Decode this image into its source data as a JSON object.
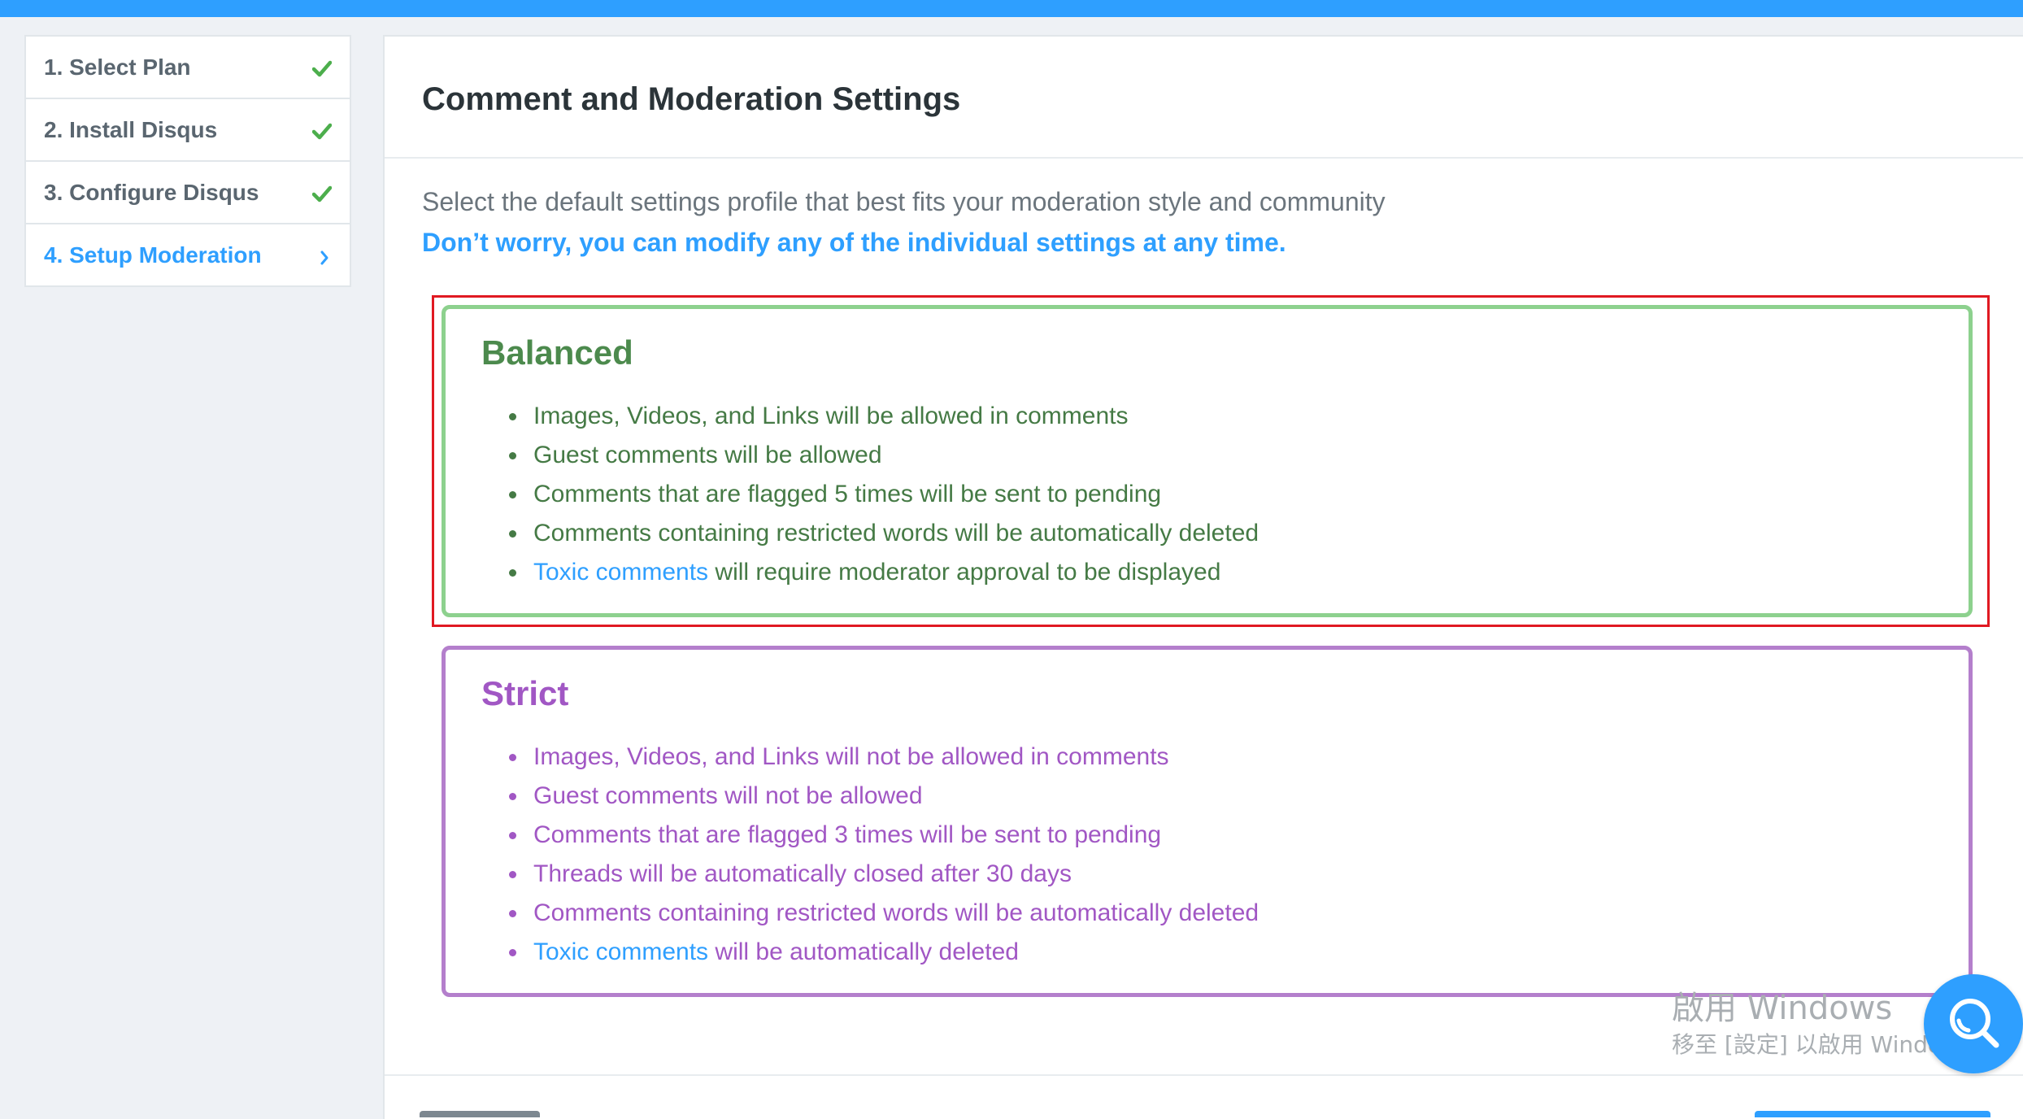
{
  "colors": {
    "brand_blue": "#2e9fff",
    "balanced_green": "#4c8a4d",
    "strict_purple": "#a157c4",
    "highlight_red": "#e01922"
  },
  "sidebar": {
    "steps": [
      {
        "label": "1. Select Plan",
        "state": "completed",
        "icon": "check-icon"
      },
      {
        "label": "2. Install Disqus",
        "state": "completed",
        "icon": "check-icon"
      },
      {
        "label": "3. Configure Disqus",
        "state": "completed",
        "icon": "check-icon"
      },
      {
        "label": "4. Setup Moderation",
        "state": "active",
        "icon": "chevron-right-icon"
      }
    ]
  },
  "main": {
    "title": "Comment and Moderation Settings",
    "intro": "Select the default settings profile that best fits your moderation style and community",
    "note": "Don’t worry, you can modify any of the individual settings at any time.",
    "profiles": [
      {
        "name": "Balanced",
        "items": [
          "Images, Videos, and Links will be allowed in comments",
          "Guest comments will be allowed",
          "Comments that are flagged 5 times will be sent to pending",
          "Comments containing restricted words will be automatically deleted"
        ],
        "toxic_link": "Toxic comments",
        "toxic_rest": " will require moderator approval to be displayed"
      },
      {
        "name": "Strict",
        "items": [
          "Images, Videos, and Links will not be allowed in comments",
          "Guest comments will not be allowed",
          "Comments that are flagged 3 times will be sent to pending",
          "Threads will be automatically closed after 30 days",
          "Comments containing restricted words will be automatically deleted"
        ],
        "toxic_link": "Toxic comments",
        "toxic_rest": " will be automatically deleted"
      }
    ]
  },
  "watermark": {
    "title": "啟用 Windows",
    "subtitle": "移至 [設定] 以啟用 Windows"
  },
  "help_button": {
    "icon": "search-icon"
  }
}
